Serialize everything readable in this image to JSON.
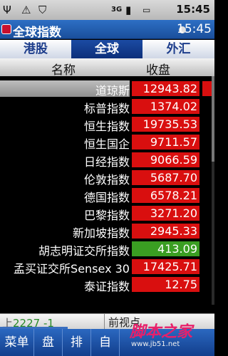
{
  "status_bar": {
    "icons": [
      "usb-icon",
      "warning-icon",
      "shield-icon",
      "3g-icon",
      "signal-icon",
      "battery-icon"
    ],
    "network": "3G",
    "time": "15:45"
  },
  "app": {
    "title": "全球指数",
    "time": "15:45"
  },
  "tabs": [
    {
      "label": "港股",
      "active": false
    },
    {
      "label": "全球",
      "active": true
    },
    {
      "label": "外汇",
      "active": false
    }
  ],
  "table": {
    "headers": {
      "name": "名称",
      "close": "收盘"
    },
    "rows": [
      {
        "name": "道琼斯",
        "close": "12943.82",
        "trend": "up",
        "selected": true
      },
      {
        "name": "标普指数",
        "close": "1374.02",
        "trend": "up",
        "selected": false
      },
      {
        "name": "恒生指数",
        "close": "19735.53",
        "trend": "up",
        "selected": false
      },
      {
        "name": "恒生国企",
        "close": "9711.57",
        "trend": "up",
        "selected": false
      },
      {
        "name": "日经指数",
        "close": "9066.59",
        "trend": "up",
        "selected": false
      },
      {
        "name": "伦敦指数",
        "close": "5687.70",
        "trend": "up",
        "selected": false
      },
      {
        "name": "德国指数",
        "close": "6578.21",
        "trend": "up",
        "selected": false
      },
      {
        "name": "巴黎指数",
        "close": "3271.20",
        "trend": "up",
        "selected": false
      },
      {
        "name": "新加坡指数",
        "close": "2945.33",
        "trend": "up",
        "selected": false
      },
      {
        "name": "胡志明证交所指数",
        "close": "413.09",
        "trend": "down",
        "selected": false
      },
      {
        "name": "孟买证交所Sensex 30",
        "close": "17425.71",
        "trend": "up",
        "selected": false
      },
      {
        "name": "泰证指数",
        "close": "12.75",
        "trend": "up",
        "selected": false
      }
    ]
  },
  "info_bar": {
    "prefix": "上",
    "value": "2227 -1",
    "right_text": "前视点"
  },
  "menu": [
    {
      "label": "菜单"
    },
    {
      "label": "盘"
    },
    {
      "label": "排"
    },
    {
      "label": "自"
    }
  ],
  "watermark": {
    "text": "脚本之家",
    "url": "www.jb51.net"
  },
  "colors": {
    "up": "#d90f0f",
    "down": "#3a9e22",
    "accent": "#1b4ba3"
  }
}
